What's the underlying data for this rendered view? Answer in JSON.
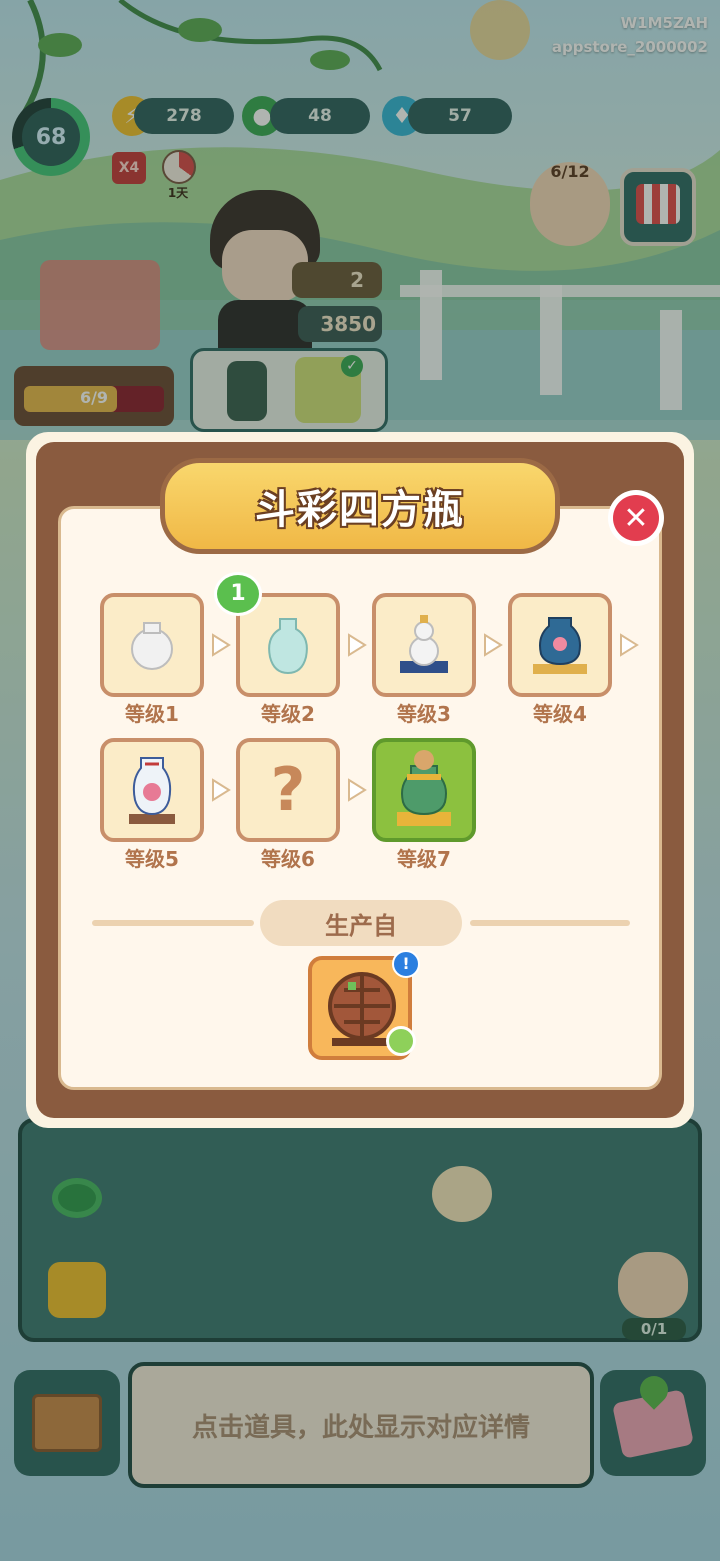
{
  "watermark": {
    "line1": "W1M5ZAH",
    "line2": "appstore_2000002"
  },
  "hud": {
    "level": "68",
    "resources": [
      {
        "icon": "lightning-icon",
        "value": "278"
      },
      {
        "icon": "jade-coin-icon",
        "value": "48"
      },
      {
        "icon": "blue-flame-icon",
        "value": "57"
      }
    ],
    "multiplier": "X4",
    "day_label": "1天",
    "customers": "6/12"
  },
  "scene": {
    "flower_count": "2",
    "flame_count": "3850",
    "build_progress": "6/9",
    "helper_count": "0/1"
  },
  "dialog": {
    "title": "斗彩四方瓶",
    "badge": "1",
    "levels": [
      {
        "label": "等级1",
        "icon": "white-vase-icon"
      },
      {
        "label": "等级2",
        "icon": "celadon-vase-icon"
      },
      {
        "label": "等级3",
        "icon": "gourd-vase-icon"
      },
      {
        "label": "等级4",
        "icon": "blue-jar-icon"
      },
      {
        "label": "等级5",
        "icon": "painted-vase-icon"
      },
      {
        "label": "等级6",
        "icon": "question-mark-icon",
        "mystery": "?"
      },
      {
        "label": "等级7",
        "icon": "treasure-jar-icon"
      }
    ],
    "produced_from": "生产自",
    "producer_icon": "curio-shelf-icon"
  },
  "bottom": {
    "hint": "点击道具，此处显示对应详情"
  }
}
